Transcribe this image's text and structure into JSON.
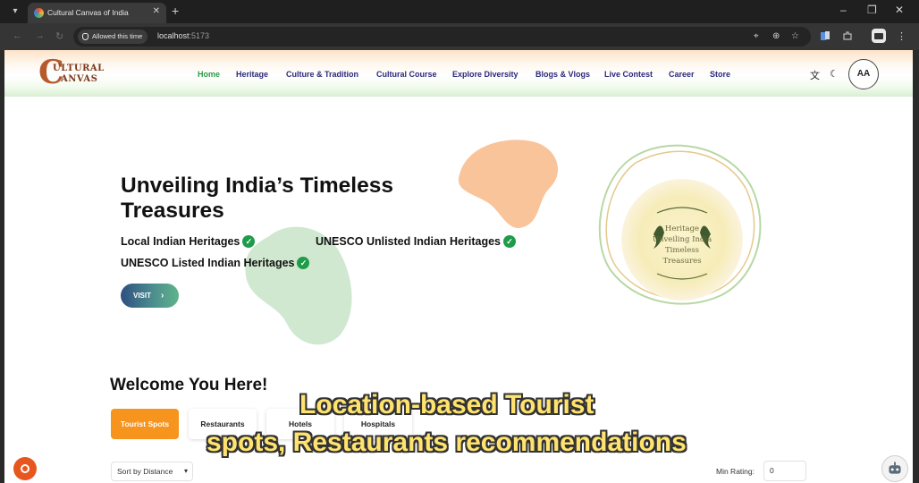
{
  "browser": {
    "tab_title": "Cultural Canvas of India",
    "permission_chip": "Allowed this time",
    "url_host": "localhost",
    "url_port": ":5173",
    "new_tab": "+",
    "minimize": "–",
    "restore": "❐",
    "close": "✕"
  },
  "site": {
    "logo_initial": "C",
    "logo_line1": "ULTURAL",
    "logo_line2": "ANVAS",
    "nav": [
      "Home",
      "Heritage",
      "Culture & Tradition",
      "Cultural Course",
      "Explore Diversity",
      "Blogs & Vlogs",
      "Live Contest",
      "Career",
      "Store"
    ],
    "avatar": "AA"
  },
  "hero": {
    "title": "Unveiling India’s Timeless Treasures",
    "items": [
      "Local Indian Heritages",
      "UNESCO Unlisted Indian Heritages",
      "UNESCO Listed Indian Heritages"
    ],
    "cta": "VISIT",
    "emblem_lines": [
      "Heritage",
      "Unveiling India",
      "Timeless",
      "Treasures"
    ]
  },
  "welcome": {
    "title": "Welcome You Here!",
    "filters": [
      "Tourist Spots",
      "Restaurants",
      "Hotels",
      "Hospitals"
    ],
    "active_filter": "Tourist Spots",
    "sort": "Sort by Distance",
    "min_rating_label": "Min Rating:",
    "min_rating_value": "0"
  },
  "subtitle": {
    "line1": "Location-based Tourist",
    "line2": "spots, Restaurants recommendations"
  },
  "colors": {
    "accent_orange": "#f7941d",
    "nav_active": "#2e9a48",
    "nav": "#2a2a7c",
    "check": "#1e9c4a"
  }
}
